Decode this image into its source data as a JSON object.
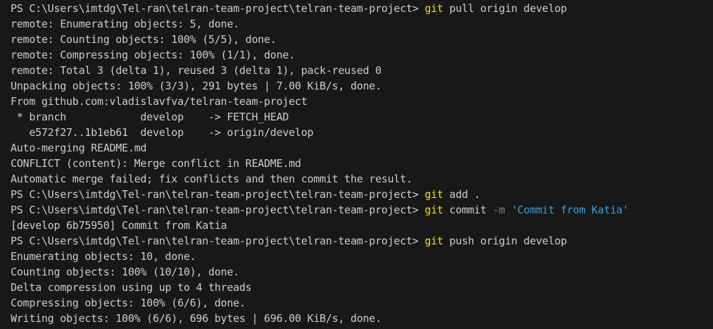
{
  "colors": {
    "background": "#181818",
    "text": "#cccccc",
    "command": "#e5e510",
    "flag": "#808080",
    "string": "#3b9fd6"
  },
  "terminal": {
    "prompt": "PS C:\\Users\\imtdg\\Tel-ran\\telran-team-project\\telran-team-project> ",
    "commands": {
      "pull": {
        "name": "git",
        "args": " pull origin develop"
      },
      "add": {
        "name": "git",
        "args": " add ."
      },
      "commit": {
        "name": "git",
        "args_before": " commit ",
        "flag": "-m",
        "space": " ",
        "message": "'Commit from Katia'"
      },
      "push": {
        "name": "git",
        "args": " push origin develop"
      }
    },
    "pull_output": [
      "remote: Enumerating objects: 5, done.",
      "remote: Counting objects: 100% (5/5), done.",
      "remote: Compressing objects: 100% (1/1), done.",
      "remote: Total 3 (delta 1), reused 3 (delta 1), pack-reused 0",
      "Unpacking objects: 100% (3/3), 291 bytes | 7.00 KiB/s, done.",
      "From github.com:vladislavfva/telran-team-project",
      " * branch            develop    -> FETCH_HEAD",
      "   e572f27..1b1eb61  develop    -> origin/develop",
      "Auto-merging README.md",
      "CONFLICT (content): Merge conflict in README.md",
      "Automatic merge failed; fix conflicts and then commit the result."
    ],
    "commit_output": [
      "[develop 6b75950] Commit from Katia"
    ],
    "push_output": [
      "Enumerating objects: 10, done.",
      "Counting objects: 100% (10/10), done.",
      "Delta compression using up to 4 threads",
      "Compressing objects: 100% (6/6), done.",
      "Writing objects: 100% (6/6), 696 bytes | 696.00 KiB/s, done."
    ]
  }
}
